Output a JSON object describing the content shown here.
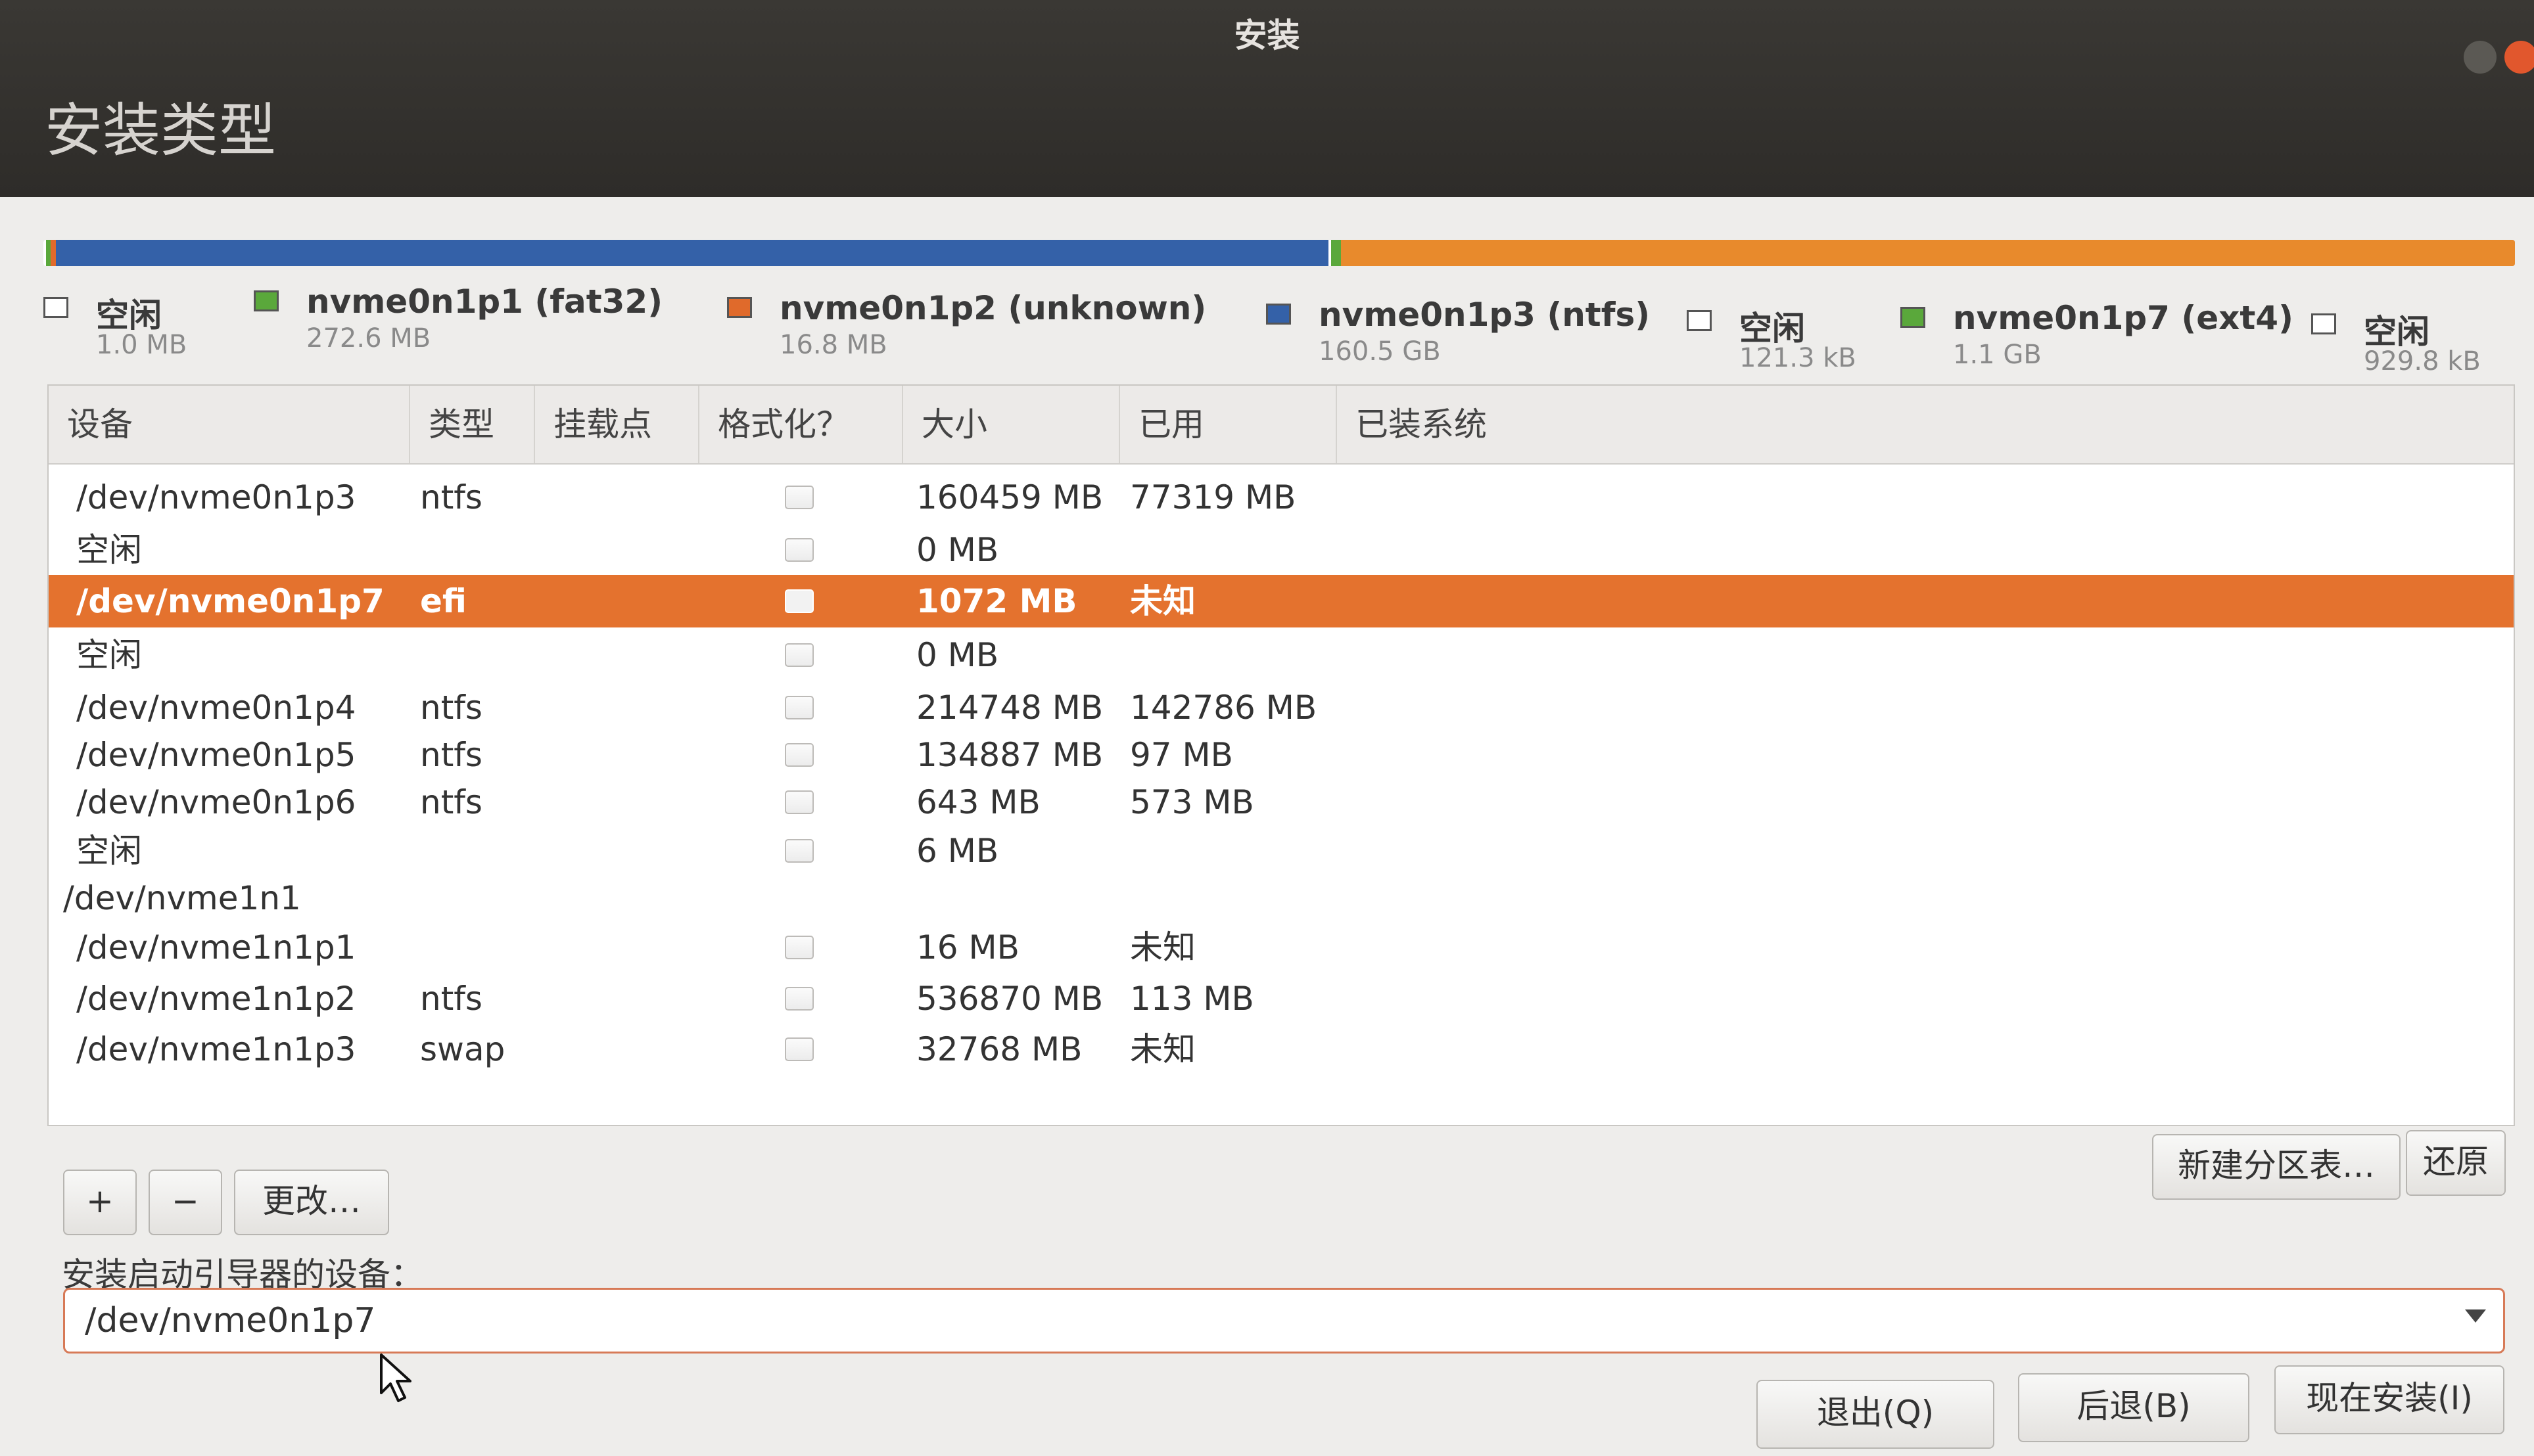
{
  "window": {
    "title": "安装"
  },
  "page": {
    "title": "安装类型"
  },
  "partition_bar": {
    "segments": [
      {
        "color": "#ffffff",
        "fraction": 0.001
      },
      {
        "color": "#5aa83b",
        "fraction": 0.002
      },
      {
        "color": "#e06a2b",
        "fraction": 0.002
      },
      {
        "color": "#3461a8",
        "fraction": 0.515
      },
      {
        "color": "#ffffff",
        "fraction": 0.001
      },
      {
        "color": "#5aa83b",
        "fraction": 0.004
      },
      {
        "color": "#e88a2c",
        "fraction": 0.475
      }
    ]
  },
  "legend": [
    {
      "label": "空闲",
      "size": "1.0 MB",
      "color": "#ffffff"
    },
    {
      "label": "nvme0n1p1 (fat32)",
      "size": "272.6 MB",
      "color": "#5aa83b"
    },
    {
      "label": "nvme0n1p2 (unknown)",
      "size": "16.8 MB",
      "color": "#e06a2b"
    },
    {
      "label": "nvme0n1p3 (ntfs)",
      "size": "160.5 GB",
      "color": "#3461a8"
    },
    {
      "label": "空闲",
      "size": "121.3 kB",
      "color": "#ffffff"
    },
    {
      "label": "nvme0n1p7 (ext4)",
      "size": "1.1 GB",
      "color": "#5aa83b"
    },
    {
      "label": "空闲",
      "size": "929.8 kB",
      "color": "#ffffff"
    }
  ],
  "table": {
    "headers": [
      "设备",
      "类型",
      "挂载点",
      "格式化？",
      "大小",
      "已用",
      "已装系统"
    ],
    "rows": [
      {
        "device": "/dev/nvme0n1p3",
        "type": "ntfs",
        "mount": "",
        "format": true,
        "size": "160459 MB",
        "used": "77319 MB",
        "system": "",
        "selected": false
      },
      {
        "device": "空闲",
        "type": "",
        "mount": "",
        "format": true,
        "size": "0 MB",
        "used": "",
        "system": "",
        "selected": false
      },
      {
        "device": "/dev/nvme0n1p7",
        "type": "efi",
        "mount": "",
        "format": true,
        "size": "1072 MB",
        "used": "未知",
        "system": "",
        "selected": true
      },
      {
        "device": "空闲",
        "type": "",
        "mount": "",
        "format": true,
        "size": "0 MB",
        "used": "",
        "system": "",
        "selected": false
      },
      {
        "device": "/dev/nvme0n1p4",
        "type": "ntfs",
        "mount": "",
        "format": true,
        "size": "214748 MB",
        "used": "142786 MB",
        "system": "",
        "selected": false
      },
      {
        "device": "/dev/nvme0n1p5",
        "type": "ntfs",
        "mount": "",
        "format": true,
        "size": "134887 MB",
        "used": "97 MB",
        "system": "",
        "selected": false
      },
      {
        "device": "/dev/nvme0n1p6",
        "type": "ntfs",
        "mount": "",
        "format": true,
        "size": "643 MB",
        "used": "573 MB",
        "system": "",
        "selected": false
      },
      {
        "device": "空闲",
        "type": "",
        "mount": "",
        "format": true,
        "size": "6 MB",
        "used": "",
        "system": "",
        "selected": false
      },
      {
        "device": "/dev/nvme1n1",
        "type": "",
        "mount": "",
        "format": false,
        "size": "",
        "used": "",
        "system": "",
        "selected": false
      },
      {
        "device": "/dev/nvme1n1p1",
        "type": "",
        "mount": "",
        "format": true,
        "size": "16 MB",
        "used": "未知",
        "system": "",
        "selected": false
      },
      {
        "device": "/dev/nvme1n1p2",
        "type": "ntfs",
        "mount": "",
        "format": true,
        "size": "536870 MB",
        "used": "113 MB",
        "system": "",
        "selected": false
      },
      {
        "device": "/dev/nvme1n1p3",
        "type": "swap",
        "mount": "",
        "format": true,
        "size": "32768 MB",
        "used": "未知",
        "system": "",
        "selected": false
      }
    ]
  },
  "toolbar": {
    "add_label": "+",
    "remove_label": "−",
    "change_label": "更改…",
    "new_table_label": "新建分区表…",
    "revert_label": "还原"
  },
  "bootloader": {
    "label": "安装启动引导器的设备：",
    "value": "/dev/nvme0n1p7"
  },
  "footer": {
    "quit_label": "退出(Q)",
    "back_label": "后退(B)",
    "install_label": "现在安装(I)"
  },
  "icons": {
    "cursor": "mouse-pointer-icon",
    "dropdown": "chevron-down-icon"
  }
}
